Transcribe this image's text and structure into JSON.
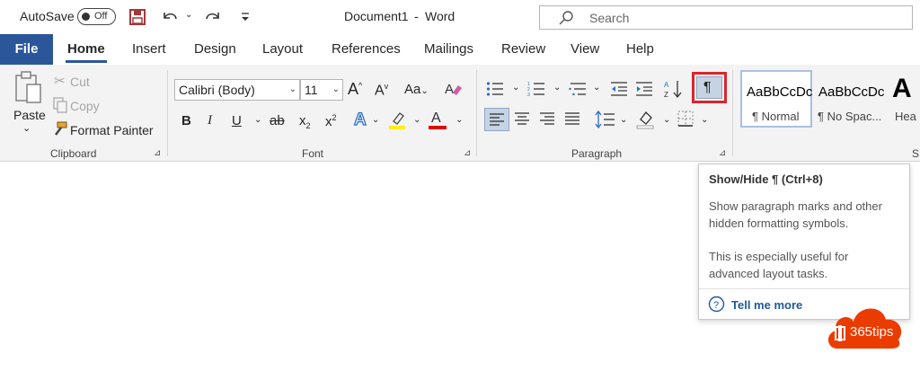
{
  "titlebar": {
    "autosave_label": "AutoSave",
    "autosave_state": "Off",
    "document_title": "Document1",
    "separator": "-",
    "app_name": "Word",
    "search_placeholder": "Search"
  },
  "tabs": {
    "file": "File",
    "items": [
      "Home",
      "Insert",
      "Design",
      "Layout",
      "References",
      "Mailings",
      "Review",
      "View",
      "Help"
    ],
    "active": "Home"
  },
  "clipboard": {
    "paste": "Paste",
    "cut": "Cut",
    "copy": "Copy",
    "format_painter": "Format Painter",
    "label": "Clipboard"
  },
  "font": {
    "font_name": "Calibri (Body)",
    "font_size": "11",
    "change_case": "Aa",
    "bold": "B",
    "italic": "I",
    "underline": "U",
    "strikethrough": "ab",
    "subscript": "x",
    "subscript_mark": "2",
    "superscript": "x",
    "superscript_mark": "2",
    "text_effects": "A",
    "font_color": "A",
    "grow": "A",
    "shrink": "A",
    "label": "Font"
  },
  "paragraph": {
    "label": "Paragraph",
    "show_hide": "¶"
  },
  "styles": {
    "items": [
      {
        "preview": "AaBbCcDc",
        "name": "¶ Normal"
      },
      {
        "preview": "AaBbCcDc",
        "name": "¶ No Spac..."
      },
      {
        "preview": "A",
        "name": "Hea"
      }
    ],
    "label_partial": "S"
  },
  "tooltip": {
    "title": "Show/Hide ¶ (Ctrl+8)",
    "line1": "Show paragraph marks and other",
    "line2": "hidden formatting symbols.",
    "line3": "This is especially useful for",
    "line4": "advanced layout tasks.",
    "link": "Tell me more"
  },
  "watermark": {
    "text": "365tips",
    "color": "#eb3c00"
  },
  "colors": {
    "file_tab": "#2b579a",
    "save_icon": "#a4373a",
    "highlight_red": "#d9262c",
    "highlighter_yellow": "#ffef00",
    "font_color_red": "#e00000"
  }
}
